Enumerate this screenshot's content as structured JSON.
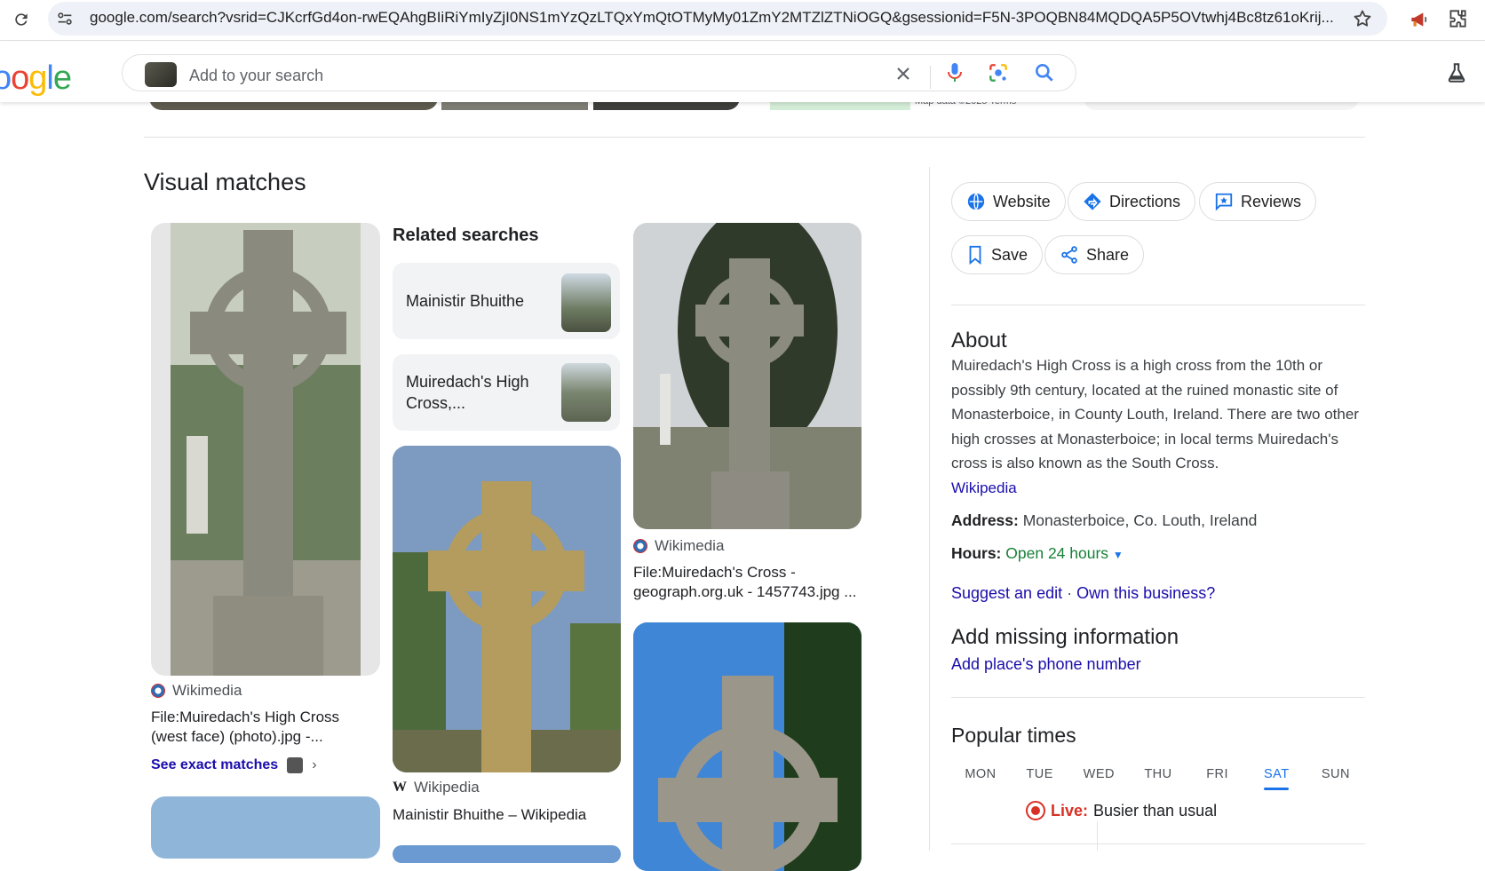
{
  "browser": {
    "url": "google.com/search?vsrid=CJKcrfGd4on-rwEQAhgBIiRiYmIyZjI0NS1mYzQzLTQxYmQtOTMyMy01ZmY2MTZlZTNiOGQ&gsessionid=F5N-3POQBN84MQDQA5P5OVtwhj4Bc8tz61oKrij..."
  },
  "header": {
    "logo_text": "oogle",
    "search_placeholder": "Add to your search"
  },
  "strip": {
    "map_text": "Map data ©2025   Terms"
  },
  "visual_matches": {
    "title": "Visual matches",
    "see_exact": "See exact matches",
    "cards": [
      {
        "source": "Wikimedia",
        "caption": "File:Muiredach's High Cross (west face) (photo).jpg -..."
      },
      {
        "source": "Wikipedia",
        "caption": "Mainistir Bhuithe – Wikipedia"
      },
      {
        "source": "Wikimedia",
        "caption": "File:Muiredach's Cross - geograph.org.uk - 1457743.jpg ..."
      }
    ]
  },
  "related": {
    "title": "Related searches",
    "items": [
      {
        "label": "Mainistir Bhuithe"
      },
      {
        "label": "Muiredach's High Cross,..."
      }
    ]
  },
  "panel": {
    "buttons": {
      "website": "Website",
      "directions": "Directions",
      "reviews": "Reviews",
      "save": "Save",
      "share": "Share"
    },
    "about_title": "About",
    "about_text": "Muiredach's High Cross is a high cross from the 10th or possibly 9th century, located at the ruined monastic site of Monasterboice, in County Louth, Ireland. There are two other high crosses at Monasterboice; in local terms Muiredach's cross is also known as the South Cross.",
    "about_source": "Wikipedia",
    "address_label": "Address:",
    "address_value": "Monasterboice, Co. Louth, Ireland",
    "hours_label": "Hours:",
    "hours_value": "Open 24 hours",
    "suggest_edit": "Suggest an edit",
    "dot_sep": "·",
    "own_business": "Own this business?",
    "missing_title": "Add missing information",
    "add_phone": "Add place's phone number",
    "popular_title": "Popular times",
    "days": [
      "MON",
      "TUE",
      "WED",
      "THU",
      "FRI",
      "SAT",
      "SUN"
    ],
    "selected_day": "SAT",
    "live_label": "Live:",
    "live_text": "Busier than usual"
  },
  "colors": {
    "link": "#1a0dab",
    "accent": "#1a73e8",
    "open": "#188038",
    "live": "#d93025"
  }
}
